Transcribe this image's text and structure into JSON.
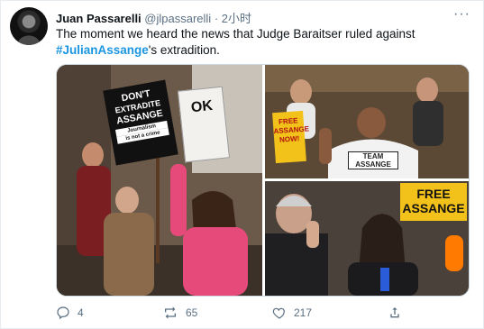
{
  "tweet": {
    "author_name": "Juan Passarelli",
    "author_handle": "@jlpassarelli",
    "separator": "·",
    "time": "2小时",
    "more_label": "···",
    "text_before": "The moment we heard the news that Judge Baraitser ruled against ",
    "hashtag": "#JulianAssange",
    "text_after": "'s extradition."
  },
  "media": {
    "photo1_sign_line1": "DON'T",
    "photo1_sign_line2": "EXTRADITE",
    "photo1_sign_line3": "ASSANGE",
    "photo1_sign_line4": "Journalism",
    "photo1_sign_line5": "is not a crime",
    "photo1_sign2": "OK",
    "photo2_sign_left": "FREE ASSANGE NOW!",
    "photo2_shirt_line1": "TEAM",
    "photo2_shirt_line2": "ASSANGE",
    "photo3_sign_line1": "FREE",
    "photo3_sign_line2": "ASSANGE"
  },
  "actions": {
    "reply_count": "4",
    "retweet_count": "65",
    "like_count": "217"
  }
}
